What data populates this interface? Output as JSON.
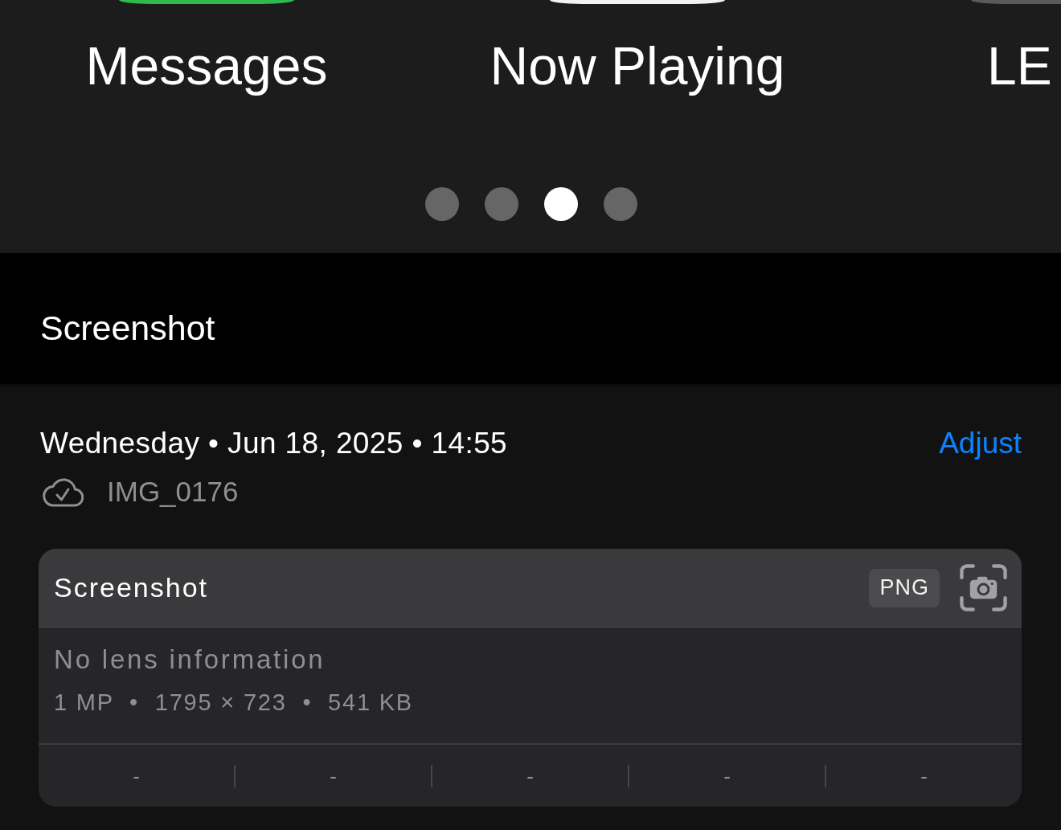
{
  "home_screen": {
    "apps": [
      {
        "label": "Messages",
        "color": "#30b94d"
      },
      {
        "label": "Now Playing",
        "color": "#f2f2f2"
      },
      {
        "label": "LE",
        "color": "#5a5a5c"
      }
    ],
    "page_dots": [
      {
        "selected": false
      },
      {
        "selected": false
      },
      {
        "selected": true
      },
      {
        "selected": false
      }
    ]
  },
  "caption": "Screenshot",
  "info": {
    "date": "Wednesday • Jun 18, 2025 • 14:55",
    "adjust": "Adjust",
    "filename": "IMG_0176"
  },
  "details_card": {
    "title": "Screenshot",
    "format": "PNG",
    "lens": "No lens information",
    "specs": "1 MP  •  1795 × 723  •  541 KB",
    "exif": [
      "-",
      "-",
      "-",
      "-",
      "-"
    ]
  }
}
